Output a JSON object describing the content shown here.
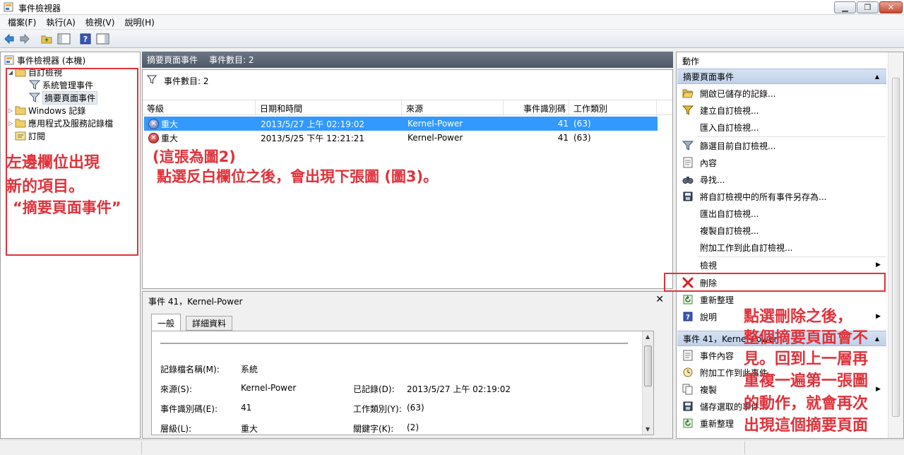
{
  "window": {
    "title": "事件檢視器"
  },
  "menu": [
    "檔案(F)",
    "執行(A)",
    "檢視(V)",
    "說明(H)"
  ],
  "tree": {
    "root": "事件檢視器 (本機)",
    "custom_views": "自訂檢視",
    "admin_events": "系統管理事件",
    "summary_events": "摘要頁面事件",
    "windows_logs": "Windows 記錄",
    "app_logs": "應用程式及服務記錄檔",
    "subscriptions": "訂閱"
  },
  "center": {
    "header_title": "摘要頁面事件",
    "header_count": "事件數目: 2",
    "filter_text": "事件數目: 2",
    "columns": [
      "等級",
      "日期和時間",
      "來源",
      "事件識別碼",
      "工作類別"
    ],
    "rows": [
      {
        "level": "重大",
        "datetime": "2013/5/27 上午 02:19:02",
        "source": "Kernel-Power",
        "event_id": "41",
        "category": "(63)"
      },
      {
        "level": "重大",
        "datetime": "2013/5/25 下午 12:21:21",
        "source": "Kernel-Power",
        "event_id": "41",
        "category": "(63)"
      }
    ]
  },
  "detail": {
    "title": "事件 41，Kernel-Power",
    "tabs": [
      "一般",
      "詳細資料"
    ],
    "labels": {
      "log_name": "記錄檔名稱(M):",
      "source": "來源(S):",
      "logged": "已記錄(D):",
      "event_id": "事件識別碼(E):",
      "task_category": "工作類別(Y):",
      "level": "層級(L):",
      "keywords": "關鍵字(K):"
    },
    "values": {
      "log_name": "系統",
      "source": "Kernel-Power",
      "logged": "2013/5/27 上午 02:19:02",
      "event_id": "41",
      "task_category": "(63)",
      "level": "重大",
      "keywords": "(2)"
    }
  },
  "actions": {
    "title": "動作",
    "section1": "摘要頁面事件",
    "items": [
      "開啟已儲存的記錄...",
      "建立自訂檢視...",
      "匯入自訂檢視...",
      "篩選目前自訂檢視...",
      "內容",
      "尋找...",
      "將自訂檢視中的所有事件另存為...",
      "匯出自訂檢視...",
      "複製自訂檢視...",
      "附加工作到此自訂檢視...",
      "檢視",
      "刪除",
      "重新整理",
      "說明"
    ],
    "section2": "事件 41，Kernel-Power",
    "items2": [
      "事件內容",
      "附加工作到此事件...",
      "複製",
      "儲存選取的事件...",
      "重新整理"
    ]
  },
  "annotations": {
    "left_line1": "左邊欄位出現",
    "left_line2": "新的項目。",
    "left_line3": "“摘要頁面事件”",
    "center_line1": "(這張為圖2)",
    "center_line2": "點選反白欄位之後，會出現下張圖 (圖3)。",
    "right_line1": "點選刪除之後，",
    "right_line2": "整個摘要頁面會不",
    "right_line3": "見。回到上一層再",
    "right_line4": "重複一遍第一張圖",
    "right_line5": "的動作，就會再次",
    "right_line6": "出現這個摘要頁面"
  },
  "colors": {
    "annotation": "#e0323a",
    "selection": "#3399ff",
    "section_bg": "#cdddf0"
  }
}
